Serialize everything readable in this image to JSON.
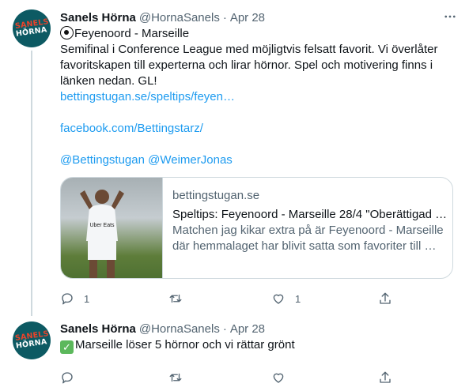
{
  "tweets": [
    {
      "avatar": {
        "line1": "SANELS",
        "line2": "HÖRNA"
      },
      "name": "Sanels Hörna",
      "handle": "@HornaSanels",
      "separator": "·",
      "date": "Apr 28",
      "lines": [
        "Feyenoord - Marseille",
        "Semifinal i Conference League med möjligtvis felsatt favorit. Vi överlåter",
        "favoritskapen till experterna och lirar hörnor. Spel och motivering finns i",
        "länken nedan. GL!"
      ],
      "links": [
        "bettingstugan.se/speltips/feyen…",
        "facebook.com/Bettingstarz/"
      ],
      "mention1": "@Bettingstugan",
      "mention2": "@WeimerJonas",
      "card": {
        "domain": "bettingstugan.se",
        "title": "Speltips: Feyenoord - Marseille 28/4 \"Oberättigad …",
        "desc1": "Matchen jag kikar extra på är Feyenoord - Marseille",
        "desc2": "där hemmalaget har blivit satta som favoriter till …",
        "jersey_text": "Uber Eats"
      },
      "counts": {
        "reply": "1",
        "retweet": "",
        "like": "1"
      }
    },
    {
      "avatar": {
        "line1": "SANELS",
        "line2": "HÖRNA"
      },
      "name": "Sanels Hörna",
      "handle": "@HornaSanels",
      "separator": "·",
      "date": "Apr 28",
      "text": "Marseille löser 5 hörnor och vi rättar grönt",
      "counts": {
        "reply": "",
        "retweet": "",
        "like": ""
      }
    }
  ],
  "colors": {
    "link": "#1d9bf0",
    "secondary": "#536471",
    "avatar_bg": "#0d5a63",
    "avatar_accent": "#e8432b"
  }
}
